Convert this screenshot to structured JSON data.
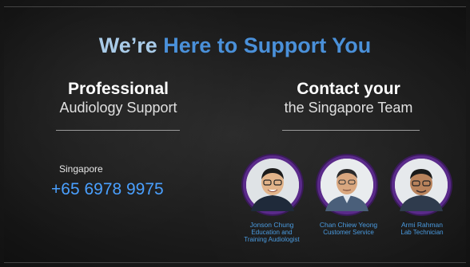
{
  "title": {
    "part1": "We’re",
    "part2": "Here to Support You"
  },
  "left": {
    "heading_bold": "Professional",
    "heading_light": "Audiology Support",
    "location": "Singapore",
    "phone": "+65 6978 9975"
  },
  "right": {
    "heading_bold": "Contact your",
    "heading_light": "the Singapore Team"
  },
  "team": [
    {
      "name": "Jonson Chung",
      "role_line1": "Education and",
      "role_line2": "Training Audiologist"
    },
    {
      "name": "Chan Chiew Yeong",
      "role_line1": "Customer Service",
      "role_line2": ""
    },
    {
      "name": "Armi Rahman",
      "role_line1": "Lab Technician",
      "role_line2": ""
    }
  ],
  "colors": {
    "accent": "#4a90d9",
    "phone": "#4aa0ff",
    "avatar_ring": "#5a2a8a",
    "background": "#1c1c1c"
  }
}
